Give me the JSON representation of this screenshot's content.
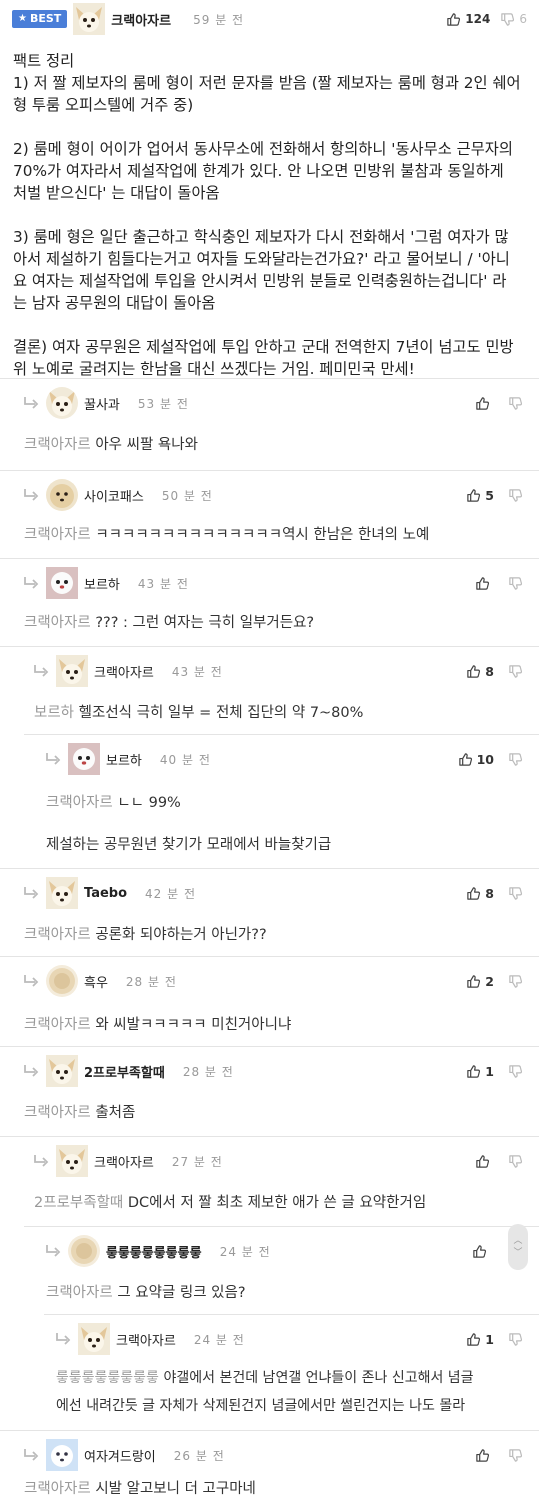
{
  "post": {
    "badge": "BEST",
    "author": "크랙아자르",
    "time": "59 분 전",
    "upvotes": "124",
    "downvotes": "6",
    "paragraphs": [
      "팩트 정리\n1) 저 짤 제보자의 룸메 형이 저런 문자를 받음 (짤 제보자는 룸메 형과 2인 쉐어\n형 투룸 오피스텔에 거주 중)",
      "2) 룸메 형이 어이가 업어서 동사무소에 전화해서 항의하니 '동사무소 근무자의\n70%가 여자라서 제설작업에 한계가 있다. 안 나오면 민방위 불참과 동일하게\n처벌 받으신다' 는 대답이 돌아옴",
      "3) 룸메 형은 일단 출근하고 학식충인 제보자가 다시 전화해서 '그럼 여자가 많\n아서 제설하기 힘들다는거고 여자들 도와달라는건가요?' 라고 물어보니 / '아니\n요 여자는 제설작업에 투입을 안시켜서 민방위 분들로 인력충원하는겁니다' 라\n는 남자 공무원의 대답이 돌아옴",
      "결론) 여자 공무원은 제설작업에 투입 안하고 군대 전역한지 7년이 넘고도 민방\n위 노예로 굴려지는 한남을 대신 쓰겠다는 거임. 페미민국 만세!"
    ]
  },
  "comments": [
    {
      "author": "꿀사과",
      "time": "53 분 전",
      "mention": "크랙아자르",
      "text": "아우 씨팔 욕나와",
      "up": ""
    },
    {
      "author": "사이코패스",
      "time": "50 분 전",
      "mention": "크랙아자르",
      "text": "ㅋㅋㅋㅋㅋㅋㅋㅋㅋㅋㅋㅋㅋㅋ역시 한남은 한녀의 노예",
      "up": "5"
    },
    {
      "author": "보르하",
      "time": "43 분 전",
      "mention": "크랙아자르",
      "text": "??? : 그런 여자는 극히 일부거든요?",
      "up": ""
    },
    {
      "author": "크랙아자르",
      "time": "43 분 전",
      "mention": "보르하",
      "text": "헬조선식 극히 일부 = 전체 집단의 약 7~80%",
      "up": "8"
    },
    {
      "author": "보르하",
      "time": "40 분 전",
      "mention": "크랙아자르",
      "text": "ㄴㄴ 99%",
      "text2": "제설하는 공무원년 찾기가 모래에서 바늘찾기급",
      "up": "10"
    },
    {
      "author": "Taebo",
      "time": "42 분 전",
      "mention": "크랙아자르",
      "text": "공론화 되야하는거 아닌가??",
      "up": "8"
    },
    {
      "author": "흑우",
      "time": "28 분 전",
      "mention": "크랙아자르",
      "text": "와 씨발ㅋㅋㅋㅋㅋ 미친거아니냐",
      "up": "2"
    },
    {
      "author": "2프로부족할때",
      "time": "28 분 전",
      "mention": "크랙아자르",
      "text": "출처좀",
      "up": "1"
    },
    {
      "author": "크랙아자르",
      "time": "27 분 전",
      "mention": "2프로부족할때",
      "text": "DC에서 저 짤 최초 제보한 애가 쓴 글 요약한거임",
      "up": ""
    },
    {
      "author": "릏릏릏릏릏릏릏릏",
      "time": "24 분 전",
      "mention": "크랙아자르",
      "text": "그 요약글 링크 있음?",
      "up": ""
    },
    {
      "author": "크랙아자르",
      "time": "24 분 전",
      "mention": "릏릏릏릏릏릏릏릏",
      "text": "야갤에서 본건데 남연갤 언냐들이 존나 신고해서 념글",
      "text2": "에선 내려간듯 글 자체가 삭제된건지 념글에서만 썰린건지는 나도 몰라",
      "up": "1"
    },
    {
      "author": "여자겨드랑이",
      "time": "26 분 전",
      "mention": "크랙아자르",
      "text": "시발 알고보니 더 고구마네",
      "up": ""
    }
  ],
  "colors": {
    "badge": "#4a7ed8",
    "mention": "#999999",
    "divider": "#e4e4e4"
  }
}
